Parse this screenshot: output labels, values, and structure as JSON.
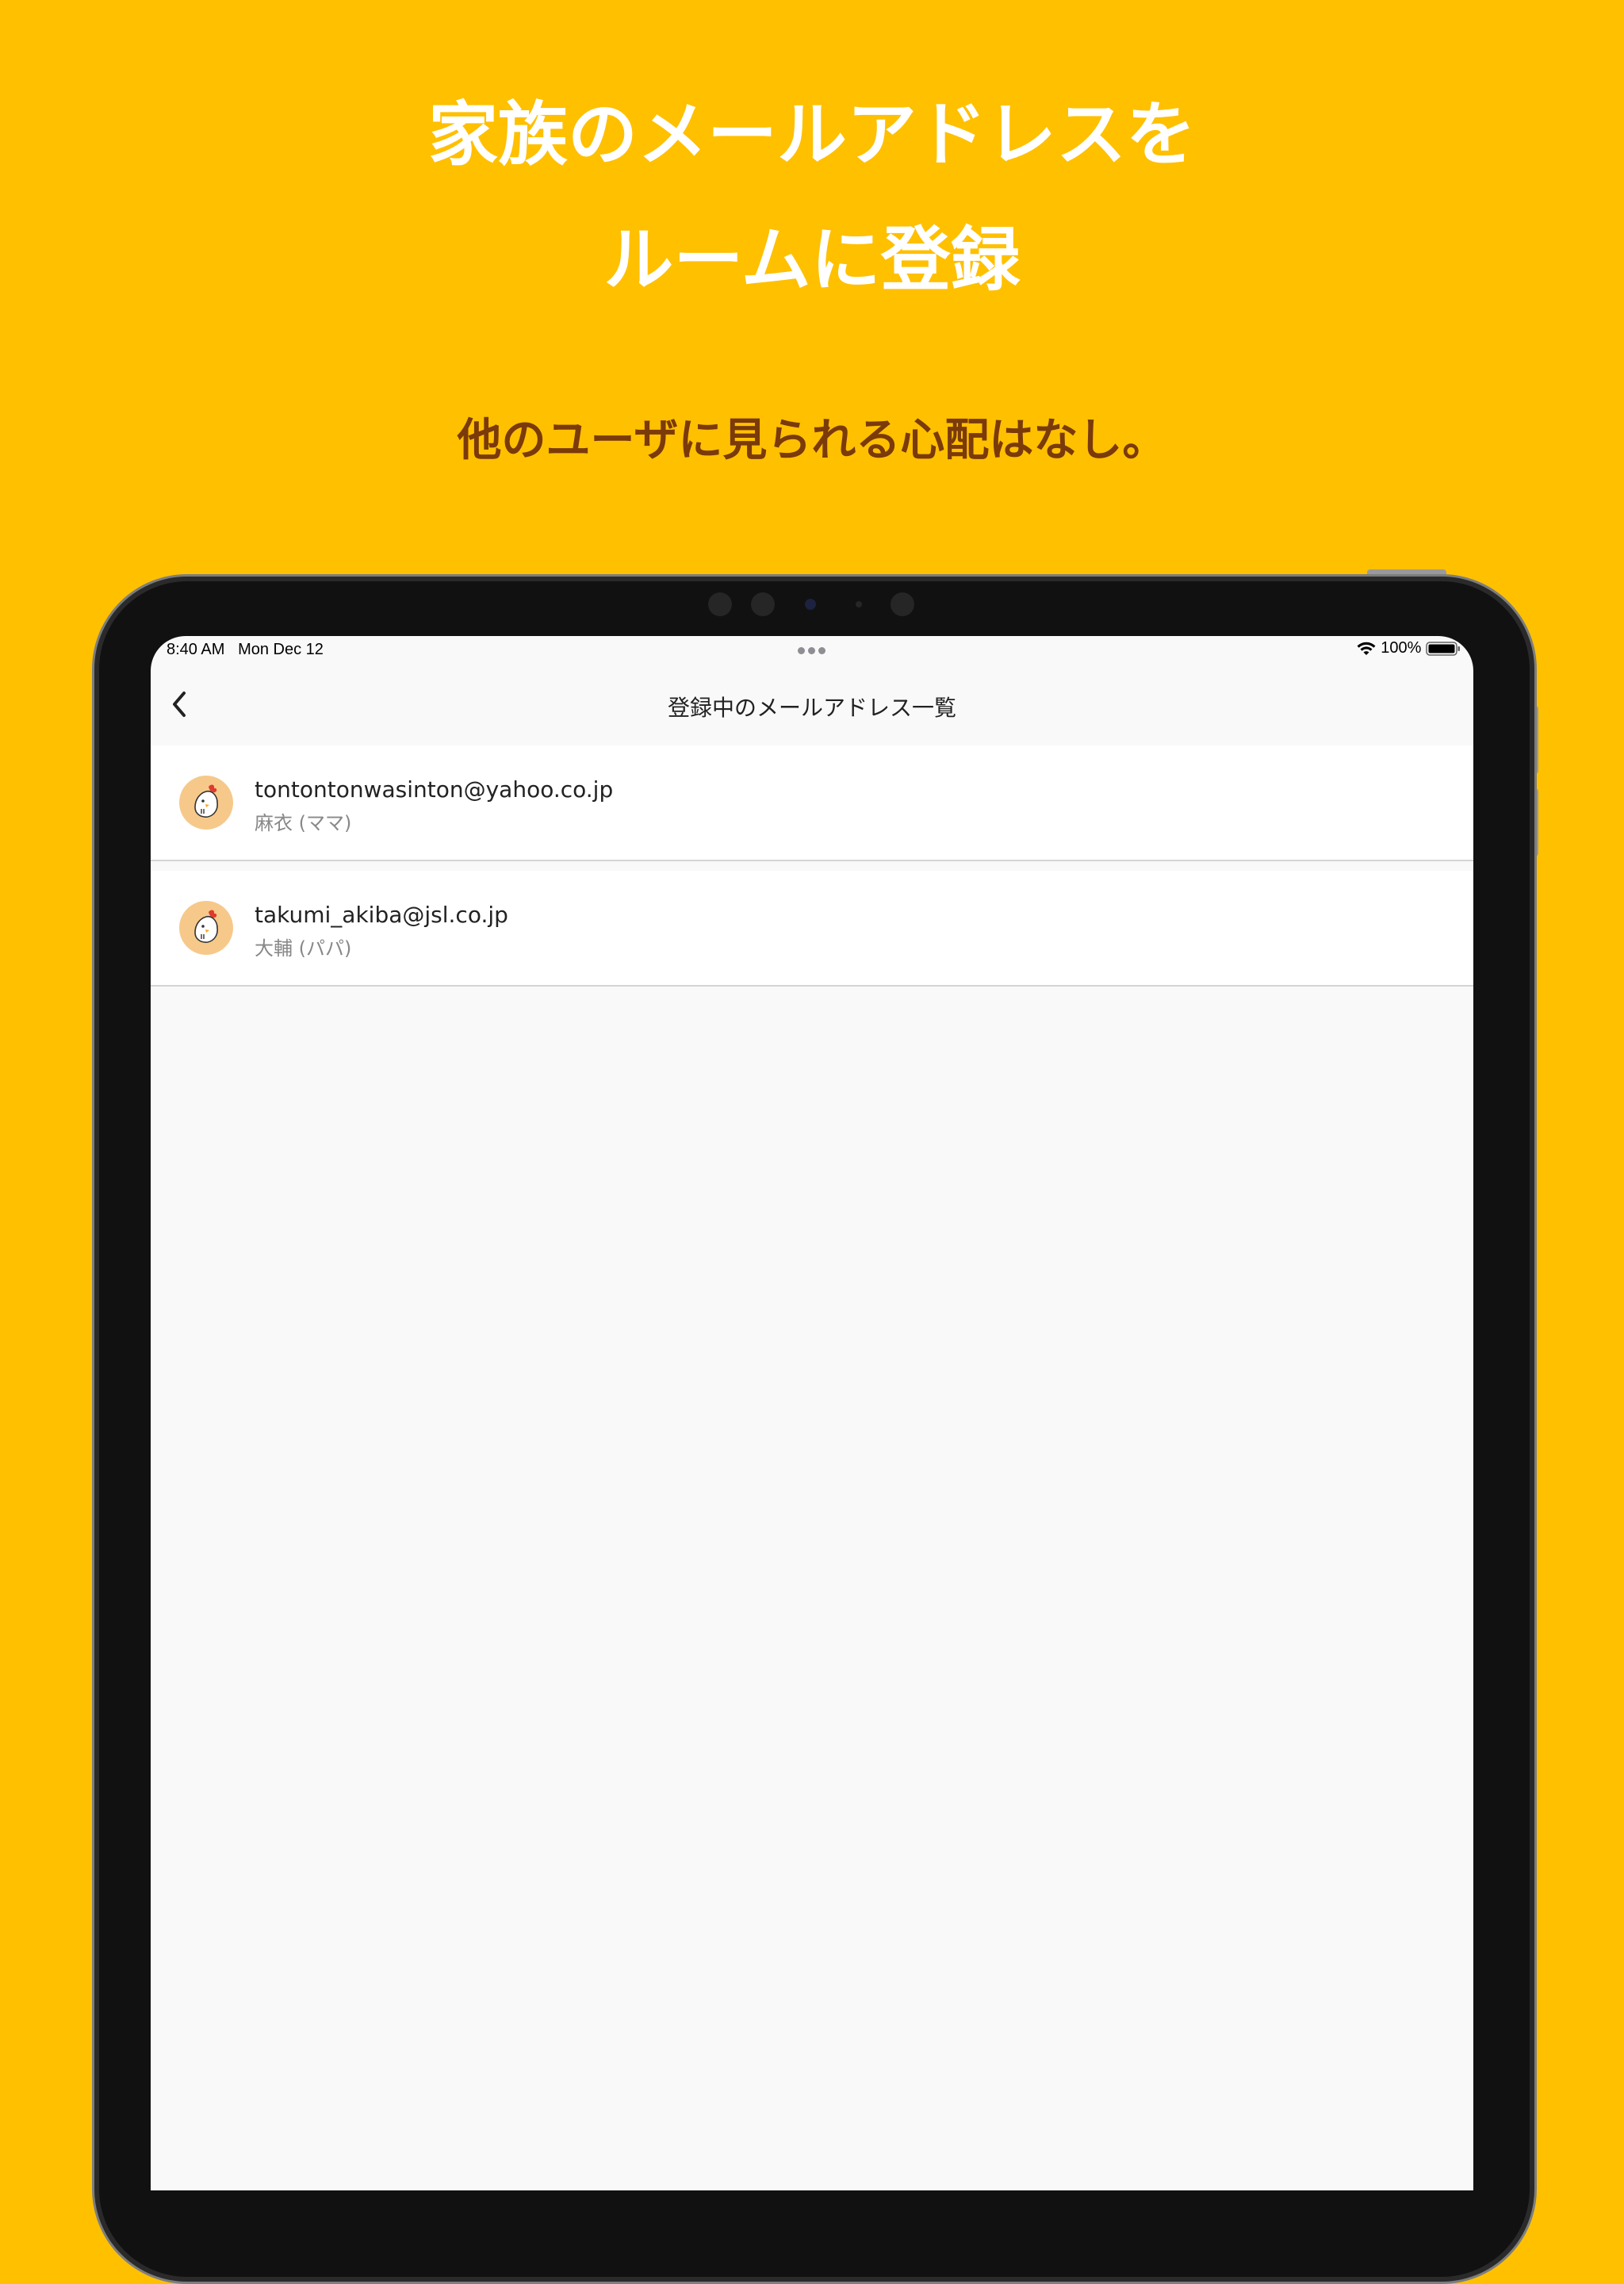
{
  "promo": {
    "headline_line1": "家族のメールアドレスを",
    "headline_line2": "ルームに登録",
    "subheadline": "他のユーザに見られる心配はなし。"
  },
  "status_bar": {
    "time": "8:40 AM",
    "date": "Mon Dec 12",
    "battery": "100%"
  },
  "nav": {
    "back_icon": "chevron-left-icon",
    "title": "登録中のメールアドレス一覧"
  },
  "members": [
    {
      "email": "tontontonwasinton@yahoo.co.jp",
      "name": "麻衣 (ママ)",
      "avatar": "chicken-avatar"
    },
    {
      "email": "takumi_akiba@jsl.co.jp",
      "name": "大輔 (パパ)",
      "avatar": "chicken-avatar"
    }
  ],
  "colors": {
    "background": "#FFC000",
    "headline": "#FFFFFF",
    "subheadline": "#7A3A0A",
    "screen": "#F9F9F9",
    "avatar_bg": "#F6C98A"
  }
}
